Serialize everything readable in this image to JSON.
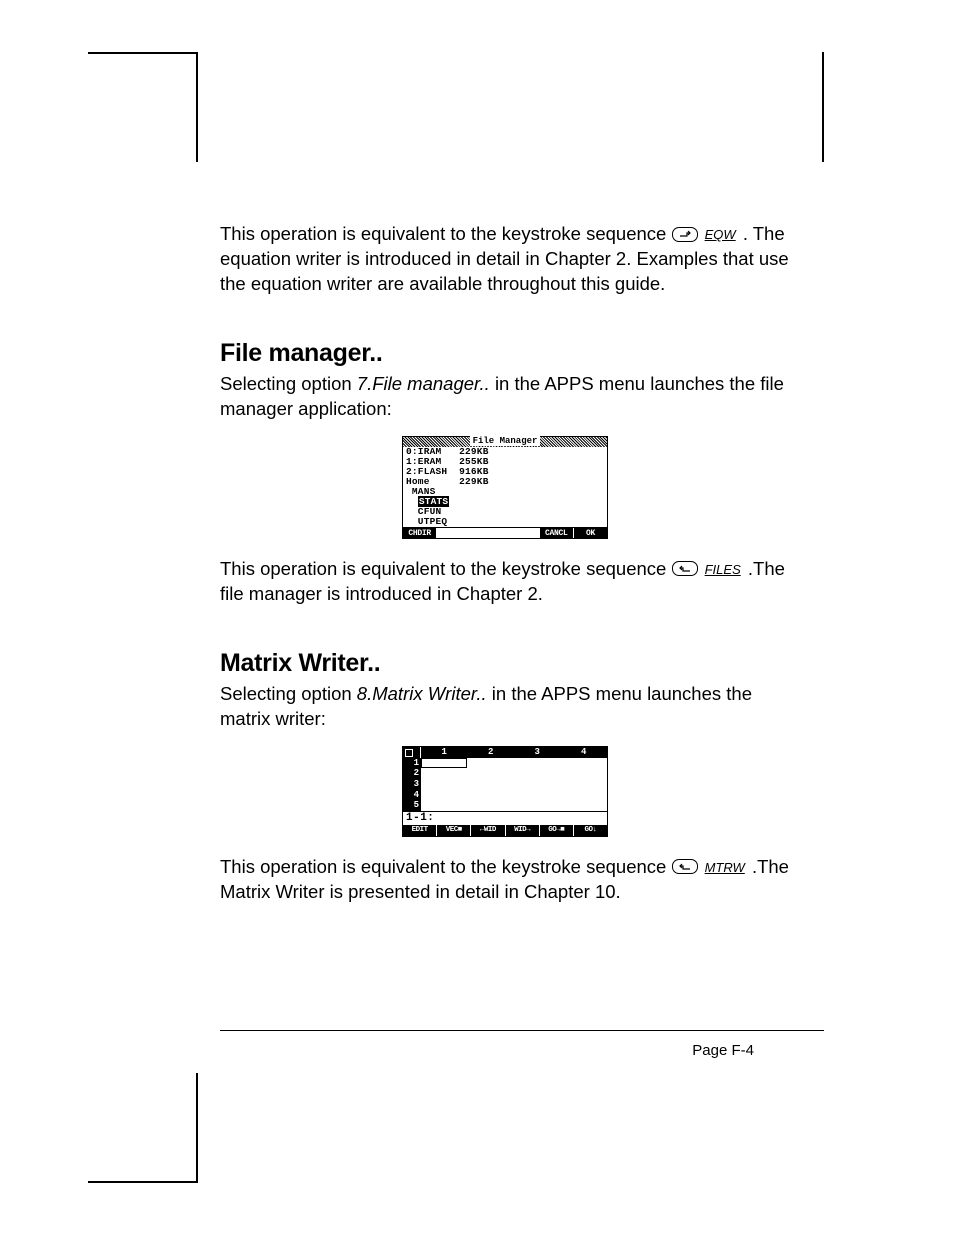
{
  "intro": {
    "p1a": "This operation is equivalent to the keystroke sequence ",
    "key1_label": "EQW",
    "p1b": ".  The equation writer is introduced in detail in Chapter 2.  Examples that use the equation writer are available throughout this guide."
  },
  "file_manager": {
    "heading": "File manager..",
    "p1a": "Selecting option ",
    "p1_option": "7.File manager..",
    "p1b": " in the APPS menu launches the file manager application:",
    "screen": {
      "title": "File Manager",
      "rows": [
        "0:IRAM   229KB",
        "1:ERAM   255KB",
        "2:FLASH  916KB",
        "Home     229KB",
        " MANS",
        "  STATS",
        "  CFUN",
        "  UTPEQ"
      ],
      "selected_row": 5,
      "softkeys": [
        "CHDIR",
        "",
        "",
        "",
        "CANCL",
        "OK"
      ]
    },
    "p2a": "This operation is equivalent to the keystroke sequence ",
    "key2_label": "FILES",
    "p2b": ".The file manager is introduced in Chapter 2."
  },
  "matrix_writer": {
    "heading": "Matrix Writer..",
    "p1a": "Selecting option ",
    "p1_option": "8.Matrix Writer..",
    "p1b": " in the APPS menu launches the matrix writer:",
    "screen": {
      "cols": [
        "1",
        "2",
        "3",
        "4"
      ],
      "rows": [
        "1",
        "2",
        "3",
        "4",
        "5"
      ],
      "status": "1-1:",
      "softkeys": [
        "EDIT",
        "VEC■",
        "←WID",
        "WID→",
        "GO→■",
        "GO↓"
      ]
    },
    "p2a": "This operation is equivalent to the keystroke sequence ",
    "key2_label": "MTRW",
    "p2b": ".The Matrix Writer is presented in detail in Chapter 10."
  },
  "footer": "Page F-4"
}
